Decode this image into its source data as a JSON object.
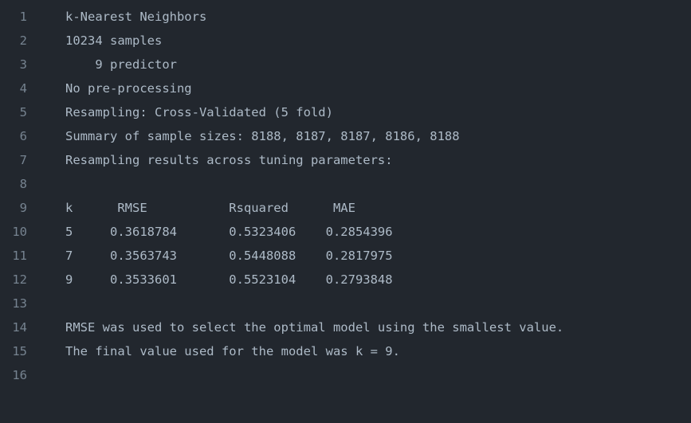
{
  "editor": {
    "lines": [
      {
        "number": "1",
        "text": "k-Nearest Neighbors"
      },
      {
        "number": "2",
        "text": "10234 samples"
      },
      {
        "number": "3",
        "text": "    9 predictor"
      },
      {
        "number": "4",
        "text": "No pre-processing"
      },
      {
        "number": "5",
        "text": "Resampling: Cross-Validated (5 fold)"
      },
      {
        "number": "6",
        "text": "Summary of sample sizes: 8188, 8187, 8187, 8186, 8188"
      },
      {
        "number": "7",
        "text": "Resampling results across tuning parameters:"
      },
      {
        "number": "8",
        "text": ""
      },
      {
        "number": "9",
        "text": "k      RMSE           Rsquared      MAE"
      },
      {
        "number": "10",
        "text": "5     0.3618784       0.5323406    0.2854396"
      },
      {
        "number": "11",
        "text": "7     0.3563743       0.5448088    0.2817975"
      },
      {
        "number": "12",
        "text": "9     0.3533601       0.5523104    0.2793848"
      },
      {
        "number": "13",
        "text": ""
      },
      {
        "number": "14",
        "text": "RMSE was used to select the optimal model using the smallest value."
      },
      {
        "number": "15",
        "text": "The final value used for the model was k = 9."
      },
      {
        "number": "16",
        "text": ""
      }
    ]
  }
}
